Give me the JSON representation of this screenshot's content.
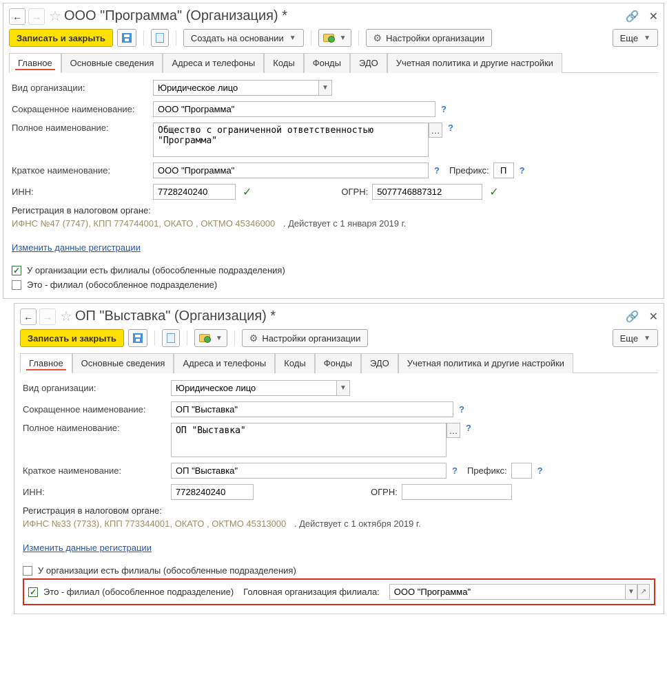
{
  "w1": {
    "title": "ООО \"Программа\" (Организация) *",
    "toolbar": {
      "save_close": "Записать и закрыть",
      "create_based": "Создать на основании",
      "settings": "Настройки организации",
      "more": "Еще"
    },
    "tabs": [
      "Главное",
      "Основные сведения",
      "Адреса и телефоны",
      "Коды",
      "Фонды",
      "ЭДО",
      "Учетная политика и другие настройки"
    ],
    "labels": {
      "org_type": "Вид организации:",
      "short_name": "Сокращенное наименование:",
      "full_name": "Полное наименование:",
      "brief_name": "Краткое наименование:",
      "inn": "ИНН:",
      "ogrn": "ОГРН:",
      "prefix": "Префикс:",
      "tax_reg": "Регистрация в налоговом органе:",
      "change_reg": "Изменить данные регистрации",
      "has_branches": "У организации есть филиалы (обособленные подразделения)",
      "is_branch": "Это - филиал (обособленное подразделение)"
    },
    "values": {
      "org_type": "Юридическое лицо",
      "short_name": "ООО \"Программа\"",
      "full_name": "Общество с ограниченной ответственностью \"Программа\"",
      "brief_name": "ООО \"Программа\"",
      "prefix": "П",
      "inn": "7728240240",
      "ogrn": "5077746887312",
      "tax_info": "ИФНС №47 (7747), КПП 774744001, ОКАТО , ОКТМО 45346000",
      "tax_valid": ". Действует с 1 января 2019 г."
    }
  },
  "w2": {
    "title": "ОП \"Выставка\" (Организация) *",
    "toolbar": {
      "save_close": "Записать и закрыть",
      "settings": "Настройки организации",
      "more": "Еще"
    },
    "tabs": [
      "Главное",
      "Основные сведения",
      "Адреса и телефоны",
      "Коды",
      "Фонды",
      "ЭДО",
      "Учетная политика и другие настройки"
    ],
    "labels": {
      "org_type": "Вид организации:",
      "short_name": "Сокращенное наименование:",
      "full_name": "Полное наименование:",
      "brief_name": "Краткое наименование:",
      "inn": "ИНН:",
      "ogrn": "ОГРН:",
      "prefix": "Префикс:",
      "tax_reg": "Регистрация в налоговом органе:",
      "change_reg": "Изменить данные регистрации",
      "has_branches": "У организации есть филиалы (обособленные подразделения)",
      "is_branch": "Это - филиал (обособленное подразделение)",
      "parent_org": "Головная организация филиала:"
    },
    "values": {
      "org_type": "Юридическое лицо",
      "short_name": "ОП \"Выставка\"",
      "full_name": "ОП \"Выставка\"",
      "brief_name": "ОП \"Выставка\"",
      "prefix": "",
      "inn": "7728240240",
      "ogrn": "",
      "tax_info": "ИФНС №33 (7733), КПП 773344001, ОКАТО , ОКТМО 45313000",
      "tax_valid": ". Действует с 1 октября 2019 г.",
      "parent_org": "ООО \"Программа\""
    }
  }
}
